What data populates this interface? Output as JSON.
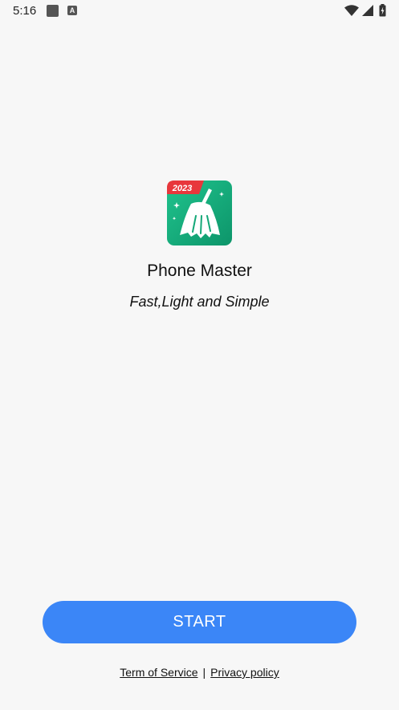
{
  "status_bar": {
    "time": "5:16",
    "icons": [
      "notification-square-icon",
      "a-notification-icon",
      "wifi-icon",
      "signal-icon",
      "battery-icon"
    ]
  },
  "app": {
    "name": "Phone Master",
    "tagline": "Fast,Light and Simple",
    "icon": {
      "name": "broom-icon",
      "badge": "2023",
      "badge_color": "#e8373c",
      "gradient_start": "#1dbf8a",
      "gradient_end": "#0f9a6e"
    }
  },
  "actions": {
    "start_label": "START",
    "start_color": "#3b86f7"
  },
  "footer": {
    "terms_label": "Term of Service",
    "separator": "|",
    "privacy_label": "Privacy policy"
  }
}
